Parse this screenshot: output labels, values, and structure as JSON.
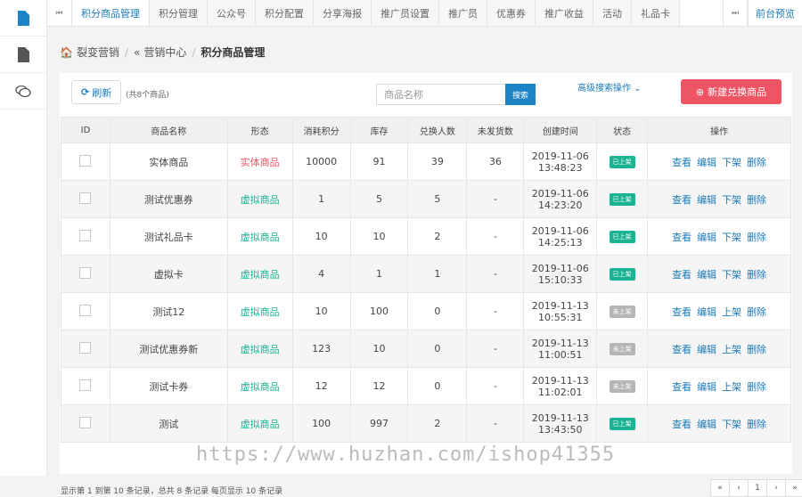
{
  "sidebar": {
    "icons": [
      "document-icon",
      "file-icon",
      "chat-icon"
    ]
  },
  "tabs": {
    "items": [
      "积分商品管理",
      "积分管理",
      "公众号",
      "积分配置",
      "分享海报",
      "推广员设置",
      "推广员",
      "优惠券",
      "推广收益",
      "活动",
      "礼品卡"
    ],
    "active": 0,
    "preview": "前台预览"
  },
  "breadcrumb": {
    "home": "裂变营销",
    "section": "营销中心",
    "current": "积分商品管理"
  },
  "toolbar": {
    "refresh_label": "刷新",
    "count_text": "(共8个商品)",
    "search_placeholder": "商品名称",
    "search_button": "搜索",
    "advanced_search": "高级搜索操作",
    "new_button": "新建兑换商品"
  },
  "table": {
    "headers": [
      "ID",
      "商品名称",
      "形态",
      "消耗积分",
      "库存",
      "兑换人数",
      "未发货数",
      "创建时间",
      "状态",
      "操作"
    ],
    "rows": [
      {
        "name": "实体商品",
        "form": "实体商品",
        "points": "10000",
        "stock": "91",
        "redeemed": "39",
        "unshipped": "36",
        "date": "2019-11-06",
        "time": "13:48:23",
        "status": "已上架",
        "on": true,
        "ops": [
          "查看",
          "编辑",
          "下架",
          "删除"
        ]
      },
      {
        "name": "测试优惠券",
        "form": "虚拟商品",
        "points": "1",
        "stock": "5",
        "redeemed": "5",
        "unshipped": "-",
        "date": "2019-11-06",
        "time": "14:23:20",
        "status": "已上架",
        "on": true,
        "ops": [
          "查看",
          "编辑",
          "下架",
          "删除"
        ]
      },
      {
        "name": "测试礼品卡",
        "form": "虚拟商品",
        "points": "10",
        "stock": "10",
        "redeemed": "2",
        "unshipped": "-",
        "date": "2019-11-06",
        "time": "14:25:13",
        "status": "已上架",
        "on": true,
        "ops": [
          "查看",
          "编辑",
          "下架",
          "删除"
        ]
      },
      {
        "name": "虚拟卡",
        "form": "虚拟商品",
        "points": "4",
        "stock": "1",
        "redeemed": "1",
        "unshipped": "-",
        "date": "2019-11-06",
        "time": "15:10:33",
        "status": "已上架",
        "on": true,
        "ops": [
          "查看",
          "编辑",
          "下架",
          "删除"
        ]
      },
      {
        "name": "测试12",
        "form": "虚拟商品",
        "points": "10",
        "stock": "100",
        "redeemed": "0",
        "unshipped": "-",
        "date": "2019-11-13",
        "time": "10:55:31",
        "status": "未上架",
        "on": false,
        "ops": [
          "查看",
          "编辑",
          "上架",
          "删除"
        ]
      },
      {
        "name": "测试优惠券新",
        "form": "虚拟商品",
        "points": "123",
        "stock": "10",
        "redeemed": "0",
        "unshipped": "-",
        "date": "2019-11-13",
        "time": "11:00:51",
        "status": "未上架",
        "on": false,
        "ops": [
          "查看",
          "编辑",
          "上架",
          "删除"
        ]
      },
      {
        "name": "测试卡券",
        "form": "虚拟商品",
        "points": "12",
        "stock": "12",
        "redeemed": "0",
        "unshipped": "-",
        "date": "2019-11-13",
        "time": "11:02:01",
        "status": "未上架",
        "on": false,
        "ops": [
          "查看",
          "编辑",
          "上架",
          "删除"
        ]
      },
      {
        "name": "测试",
        "form": "虚拟商品",
        "points": "100",
        "stock": "997",
        "redeemed": "2",
        "unshipped": "-",
        "date": "2019-11-13",
        "time": "13:43:50",
        "status": "已上架",
        "on": true,
        "ops": [
          "查看",
          "编辑",
          "下架",
          "删除"
        ]
      }
    ]
  },
  "footer": {
    "summary": "显示第 1 到第 10 条记录，总共 8 条记录 每页显示 10 条记录",
    "pager": [
      "«",
      "‹",
      "1",
      "›",
      "»"
    ]
  },
  "watermark": "https://www.huzhan.com/ishop41355",
  "colors": {
    "primary": "#1c84c6",
    "danger": "#ed5565",
    "success": "#1ab394",
    "muted": "#b5b5b5"
  }
}
